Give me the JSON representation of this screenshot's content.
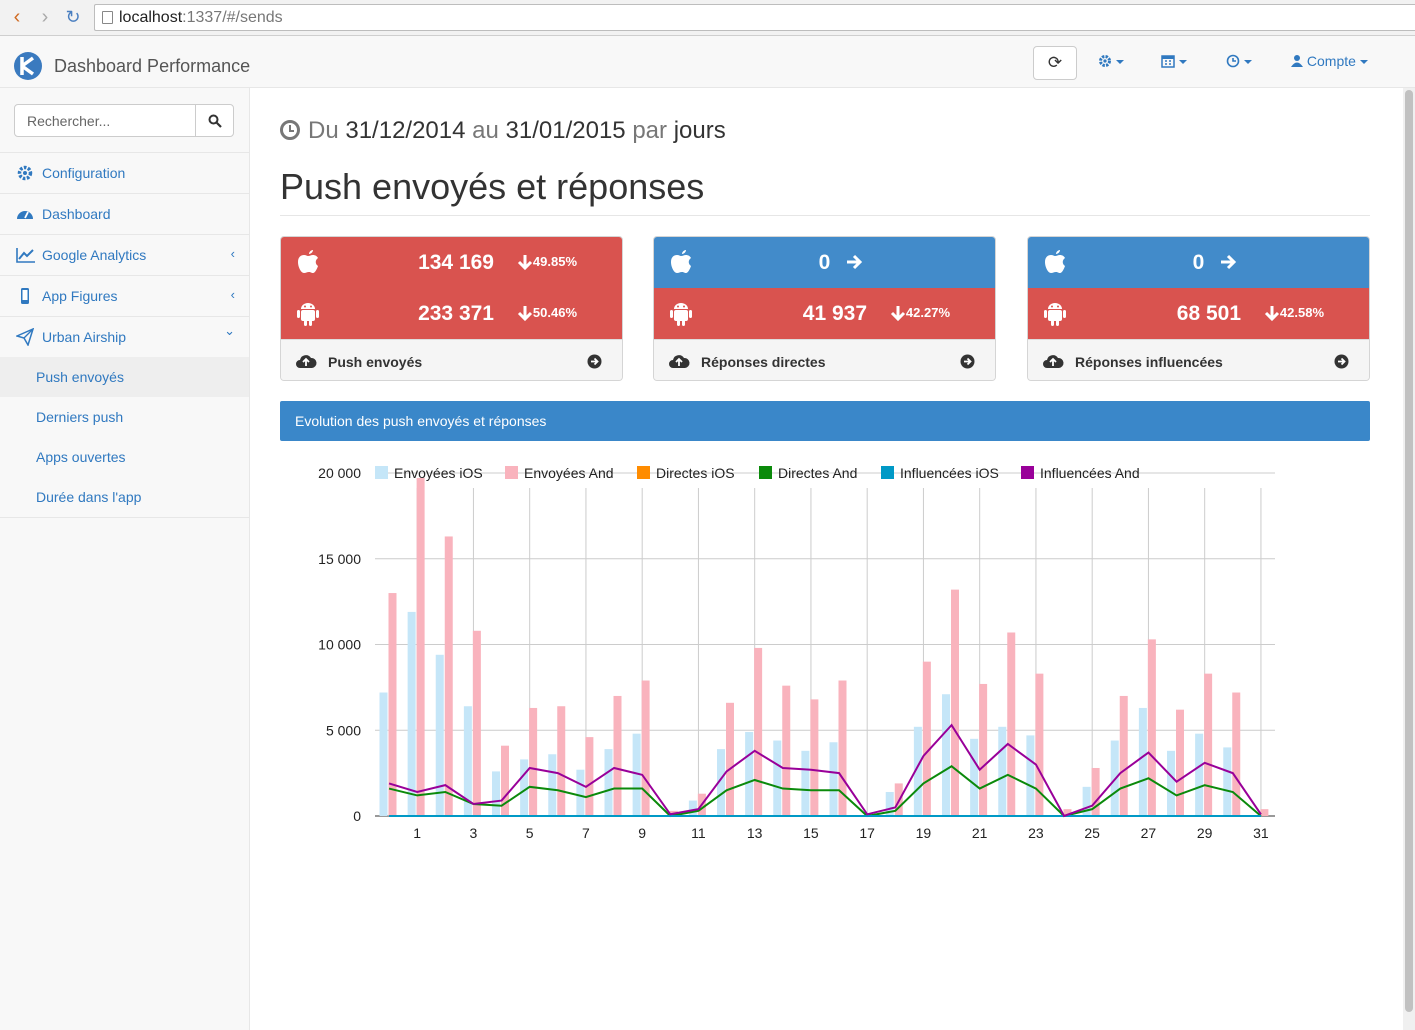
{
  "browser": {
    "url_host": "localhost",
    "url_path": ":1337/#/sends"
  },
  "header": {
    "brand": "Dashboard Performance",
    "account_label": "Compte"
  },
  "sidebar": {
    "search_placeholder": "Rechercher...",
    "items": [
      {
        "label": "Configuration",
        "icon": "gear-icon"
      },
      {
        "label": "Dashboard",
        "icon": "dashboard-icon"
      },
      {
        "label": "Google Analytics",
        "icon": "line-chart-icon",
        "chevron": "‹"
      },
      {
        "label": "App Figures",
        "icon": "mobile-icon",
        "chevron": "‹"
      },
      {
        "label": "Urban Airship",
        "icon": "paper-plane-icon",
        "chevron": "⌄"
      }
    ],
    "subitems": [
      {
        "label": "Push envoyés",
        "active": true
      },
      {
        "label": "Derniers push"
      },
      {
        "label": "Apps ouvertes"
      },
      {
        "label": "Durée dans l'app"
      }
    ]
  },
  "period": {
    "prefix": "Du",
    "start": "31/12/2014",
    "middle": "au",
    "end": "31/01/2015",
    "per": "par",
    "unit": "jours"
  },
  "page_title": "Push envoyés et réponses",
  "panels": [
    {
      "ios_value": "134 169",
      "ios_pct": "49.85%",
      "ios_trend": "down",
      "android_value": "233 371",
      "android_pct": "50.46%",
      "android_trend": "down",
      "label": "Push envoyés"
    },
    {
      "ios_value": "0",
      "ios_pct": "",
      "ios_trend": "right",
      "android_value": "41 937",
      "android_pct": "42.27%",
      "android_trend": "down",
      "label": "Réponses directes"
    },
    {
      "ios_value": "0",
      "ios_pct": "",
      "ios_trend": "right",
      "android_value": "68 501",
      "android_pct": "42.58%",
      "android_trend": "down",
      "label": "Réponses influencées"
    }
  ],
  "chart_title": "Evolution des push envoyés et réponses",
  "colors": {
    "red": "#d9534f",
    "blue": "#428bca",
    "header_blue": "#3a87c9",
    "link": "#3079c0"
  },
  "chart_data": {
    "type": "bar",
    "x": [
      0,
      1,
      2,
      3,
      4,
      5,
      6,
      7,
      8,
      9,
      10,
      11,
      12,
      13,
      14,
      15,
      16,
      17,
      18,
      19,
      20,
      21,
      22,
      23,
      24,
      25,
      26,
      27,
      28,
      29,
      30,
      31
    ],
    "x_tick_labels": [
      "1",
      "3",
      "5",
      "7",
      "9",
      "11",
      "13",
      "15",
      "17",
      "19",
      "21",
      "23",
      "25",
      "27",
      "29",
      "31"
    ],
    "y_ticks": [
      "0",
      "5 000",
      "10 000",
      "15 000",
      "20 000"
    ],
    "ylim": [
      0,
      20000
    ],
    "legend_position": "top",
    "grid": true,
    "series": [
      {
        "name": "Envoyées iOS",
        "kind": "bar",
        "color": "#c5e6f8",
        "values": [
          7200,
          11900,
          9400,
          6400,
          2600,
          3300,
          3600,
          2700,
          3900,
          4800,
          0,
          900,
          3900,
          4900,
          4400,
          3800,
          4300,
          0,
          1400,
          5200,
          7100,
          4500,
          5200,
          4700,
          0,
          1700,
          4400,
          6300,
          3800,
          4800,
          4000,
          0
        ]
      },
      {
        "name": "Envoyées And",
        "kind": "bar",
        "color": "#f9b3bd",
        "values": [
          13000,
          21000,
          16300,
          10800,
          4100,
          6300,
          6400,
          4600,
          7000,
          7900,
          300,
          1300,
          6600,
          9800,
          7600,
          6800,
          7900,
          100,
          1900,
          9000,
          13200,
          7700,
          10700,
          8300,
          400,
          2800,
          7000,
          10300,
          6200,
          8300,
          7200,
          400
        ]
      },
      {
        "name": "Directes iOS",
        "kind": "line",
        "color": "#ff8c00",
        "values": [
          0,
          0,
          0,
          0,
          0,
          0,
          0,
          0,
          0,
          0,
          0,
          0,
          0,
          0,
          0,
          0,
          0,
          0,
          0,
          0,
          0,
          0,
          0,
          0,
          0,
          0,
          0,
          0,
          0,
          0,
          0,
          0
        ]
      },
      {
        "name": "Directes And",
        "kind": "line",
        "color": "#0b8a0b",
        "values": [
          1600,
          1200,
          1400,
          700,
          600,
          1700,
          1500,
          1100,
          1600,
          1600,
          0,
          300,
          1500,
          2100,
          1600,
          1500,
          1500,
          0,
          300,
          1900,
          2900,
          1600,
          2400,
          1600,
          0,
          400,
          1600,
          2200,
          1200,
          1800,
          1400,
          0
        ]
      },
      {
        "name": "Influencées iOS",
        "kind": "line",
        "color": "#0099c6",
        "values": [
          0,
          0,
          0,
          0,
          0,
          0,
          0,
          0,
          0,
          0,
          0,
          0,
          0,
          0,
          0,
          0,
          0,
          0,
          0,
          0,
          0,
          0,
          0,
          0,
          0,
          0,
          0,
          0,
          0,
          0,
          0,
          0
        ]
      },
      {
        "name": "Influencées And",
        "kind": "line",
        "color": "#990099",
        "values": [
          1900,
          1400,
          1800,
          700,
          900,
          2800,
          2500,
          1700,
          2800,
          2400,
          100,
          400,
          2600,
          3800,
          2800,
          2700,
          2500,
          100,
          500,
          3500,
          5300,
          2700,
          4200,
          3000,
          0,
          600,
          2500,
          3700,
          2000,
          3100,
          2500,
          100
        ]
      }
    ]
  }
}
